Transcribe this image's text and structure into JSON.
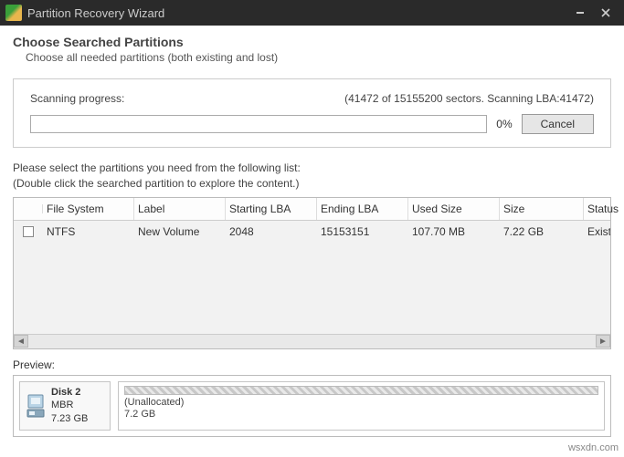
{
  "window": {
    "title": "Partition Recovery Wizard"
  },
  "header": {
    "title": "Choose Searched Partitions",
    "subtitle": "Choose all needed partitions (both existing and lost)"
  },
  "scanning": {
    "label": "Scanning progress:",
    "status": "(41472 of 15155200 sectors. Scanning LBA:41472)",
    "percent": "0%",
    "cancel": "Cancel"
  },
  "instruction": {
    "line1": "Please select the partitions you need from the following list:",
    "line2": "(Double click the searched partition to explore the content.)"
  },
  "list": {
    "headers": {
      "chk": "",
      "fs": "File System",
      "label": "Label",
      "startlba": "Starting LBA",
      "endlba": "Ending LBA",
      "used": "Used Size",
      "size": "Size",
      "status": "Status"
    },
    "rows": [
      {
        "fs": "NTFS",
        "label": "New Volume",
        "startlba": "2048",
        "endlba": "15153151",
        "used": "107.70 MB",
        "size": "7.22 GB",
        "status": "Exist"
      }
    ]
  },
  "preview": {
    "label": "Preview:",
    "disk": {
      "name": "Disk 2",
      "scheme": "MBR",
      "size": "7.23 GB"
    },
    "partition": {
      "name": "(Unallocated)",
      "size": "7.2 GB"
    }
  },
  "watermark": "wsxdn.com"
}
